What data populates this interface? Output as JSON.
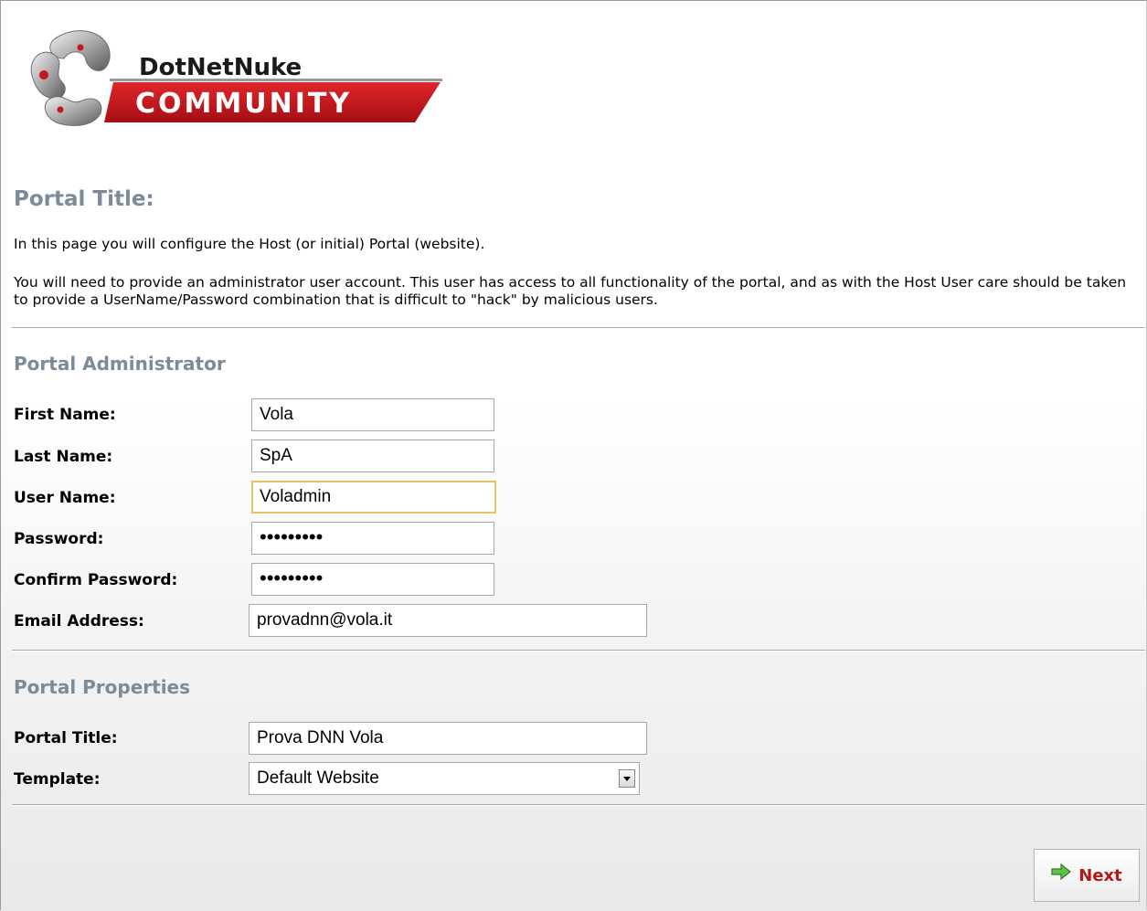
{
  "logo": {
    "line1": "DotNetNuke",
    "line2": "COMMUNITY"
  },
  "page_title": "Portal Title:",
  "intro": {
    "line1": "In this page you will configure the Host (or initial) Portal (website).",
    "line2": "You will need to provide an administrator user account. This user has access to all functionality of the portal, and as with the Host User care should be taken to provide a UserName/Password combination that is difficult to \"hack\" by malicious users."
  },
  "admin_section": {
    "title": "Portal Administrator",
    "first_name": {
      "label": "First Name:",
      "value": "Vola"
    },
    "last_name": {
      "label": "Last Name:",
      "value": "SpA"
    },
    "user_name": {
      "label": "User Name:",
      "value": "Voladmin"
    },
    "password": {
      "label": "Password:",
      "value": "•••••••••"
    },
    "confirm_password": {
      "label": "Confirm Password:",
      "value": "•••••••••"
    },
    "email": {
      "label": "Email Address:",
      "value": "provadnn@vola.it"
    }
  },
  "properties_section": {
    "title": "Portal Properties",
    "portal_title": {
      "label": "Portal Title:",
      "value": "Prova DNN Vola"
    },
    "template": {
      "label": "Template:",
      "value": "Default Website"
    }
  },
  "next_button": {
    "label": "Next",
    "icon": "green-right-arrow-icon"
  },
  "colors": {
    "heading": "#7c8b99",
    "button_text": "#b21a1a",
    "logo_red": "#c4161c",
    "focus_border": "#e5c365"
  }
}
